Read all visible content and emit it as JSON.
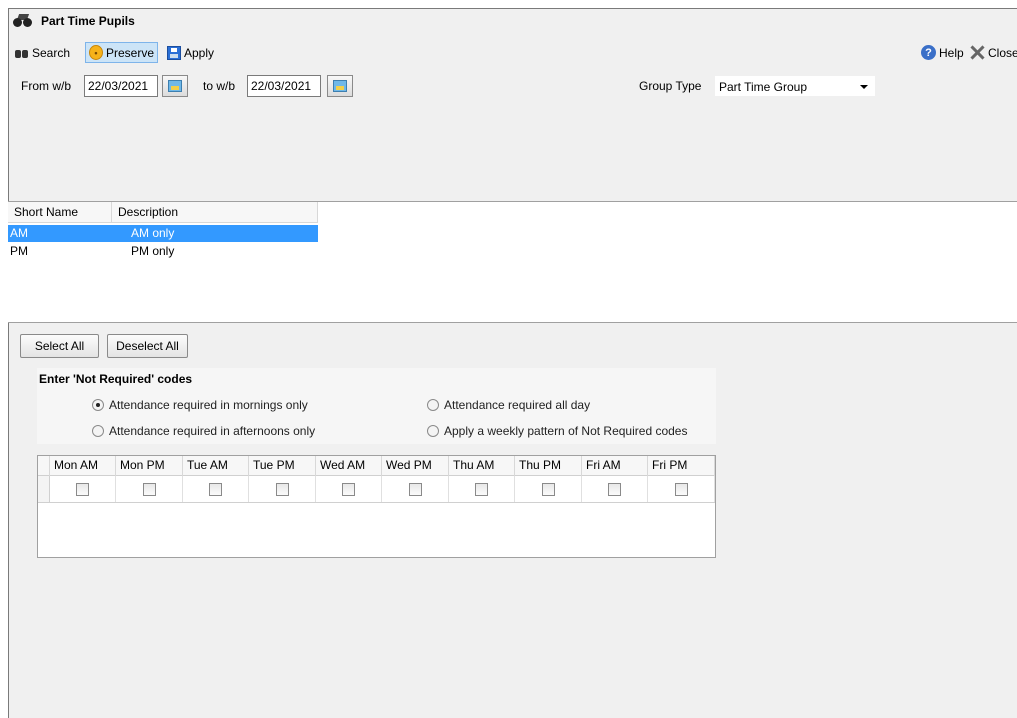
{
  "window": {
    "title": "Part Time Pupils"
  },
  "toolbar": {
    "search_label": "Search",
    "preserve_label": "Preserve",
    "apply_label": "Apply",
    "help_label": "Help",
    "close_label": "Close"
  },
  "filters": {
    "from_label": "From w/b",
    "from_value": "22/03/2021",
    "to_label": "to w/b",
    "to_value": "22/03/2021",
    "group_type_label": "Group Type",
    "group_type_value": "Part Time Group"
  },
  "groups_table": {
    "columns": [
      "Short Name",
      "Description"
    ],
    "rows": [
      {
        "short": "AM",
        "desc": "AM only",
        "selected": true
      },
      {
        "short": "PM",
        "desc": "PM only",
        "selected": false
      }
    ]
  },
  "buttons": {
    "select_all": "Select All",
    "deselect_all": "Deselect All"
  },
  "not_required": {
    "title": "Enter 'Not Required' codes",
    "options": [
      "Attendance required in mornings only",
      "Attendance required all day",
      "Attendance required in afternoons only",
      "Apply a weekly pattern of Not Required codes"
    ],
    "selected_index": 0
  },
  "sessions_table": {
    "columns": [
      "Mon AM",
      "Mon PM",
      "Tue AM",
      "Tue PM",
      "Wed AM",
      "Wed PM",
      "Thu AM",
      "Thu PM",
      "Fri AM",
      "Fri PM"
    ]
  },
  "colors": {
    "selection": "#3399ff",
    "active_button": "#cce4f7"
  }
}
